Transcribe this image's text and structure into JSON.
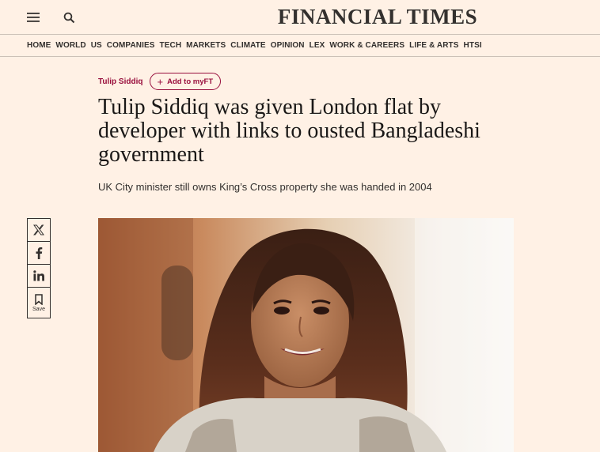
{
  "header": {
    "masthead": "FINANCIAL TIMES",
    "menu_icon": "hamburger-menu-icon",
    "search_icon": "search-icon"
  },
  "nav": {
    "items": [
      "HOME",
      "WORLD",
      "US",
      "COMPANIES",
      "TECH",
      "MARKETS",
      "CLIMATE",
      "OPINION",
      "LEX",
      "WORK & CAREERS",
      "LIFE & ARTS",
      "HTSI"
    ]
  },
  "article": {
    "topic": "Tulip Siddiq",
    "add_to_myft": "Add to myFT",
    "headline": "Tulip Siddiq was given London flat by developer with links to ousted Bangladeshi government",
    "standfirst": "UK City minister still owns King’s Cross property she was handed in 2004"
  },
  "share": {
    "x_icon": "x-logo-icon",
    "facebook_icon": "facebook-icon",
    "linkedin_icon": "linkedin-icon",
    "save_icon": "bookmark-icon",
    "save_label": "Save"
  },
  "colors": {
    "background": "#fff1e5",
    "accent": "#990f3d",
    "text": "#33302e"
  }
}
